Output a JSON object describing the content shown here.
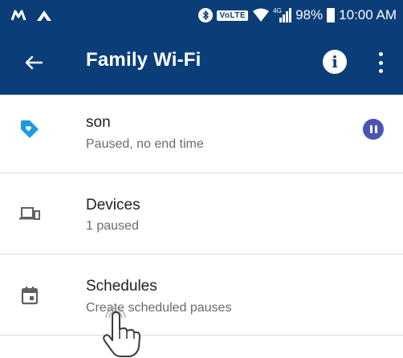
{
  "status_bar": {
    "left_icons": [
      "m-icon",
      "app-notification-icon"
    ],
    "volte": "VoLTE",
    "signal_label": "4G",
    "battery_percent": "98%",
    "time": "10:00 AM"
  },
  "app_bar": {
    "title": "Family Wi-Fi"
  },
  "rows": [
    {
      "name": "son",
      "subtitle": "Paused, no end time",
      "icon": "tag-heart-icon",
      "paused_badge": true
    },
    {
      "name": "Devices",
      "subtitle": "1 paused",
      "icon": "devices-icon"
    },
    {
      "name": "Schedules",
      "subtitle": "Create scheduled pauses",
      "icon": "calendar-icon"
    }
  ],
  "colors": {
    "header": "#0b3e78",
    "tag_icon": "#1e9be0",
    "pause_badge": "#4b54b5"
  }
}
